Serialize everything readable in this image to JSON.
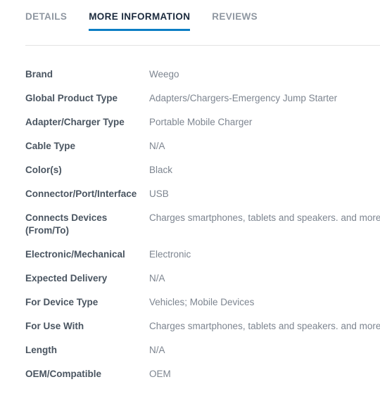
{
  "tabs": [
    {
      "label": "Details",
      "active": false
    },
    {
      "label": "More Information",
      "active": true
    },
    {
      "label": "Reviews",
      "active": false
    }
  ],
  "colors": {
    "accent": "#0c7ec4",
    "tab_active_text": "#1b2a3d",
    "tab_inactive_text": "#8f97a1",
    "label_text": "#4a5561",
    "value_text": "#7d8590",
    "divider": "#e3e3e3",
    "background": "#ffffff"
  },
  "more_information": {
    "rows": [
      {
        "label": "Brand",
        "value": "Weego"
      },
      {
        "label": "Global Product Type",
        "value": "Adapters/Chargers-Emergency Jump Starter"
      },
      {
        "label": "Adapter/Charger Type",
        "value": "Portable Mobile Charger"
      },
      {
        "label": "Cable Type",
        "value": "N/A"
      },
      {
        "label": "Color(s)",
        "value": "Black"
      },
      {
        "label": "Connector/Port/Interface",
        "value": "USB"
      },
      {
        "label": "Connects Devices (From/To)",
        "value": "Charges smartphones, tablets and speakers. and more."
      },
      {
        "label": "Electronic/Mechanical",
        "value": "Electronic"
      },
      {
        "label": "Expected Delivery",
        "value": "N/A"
      },
      {
        "label": "For Device Type",
        "value": "Vehicles; Mobile Devices"
      },
      {
        "label": "For Use With",
        "value": "Charges smartphones, tablets and speakers. and more."
      },
      {
        "label": "Length",
        "value": "N/A"
      },
      {
        "label": "OEM/Compatible",
        "value": "OEM"
      }
    ]
  }
}
